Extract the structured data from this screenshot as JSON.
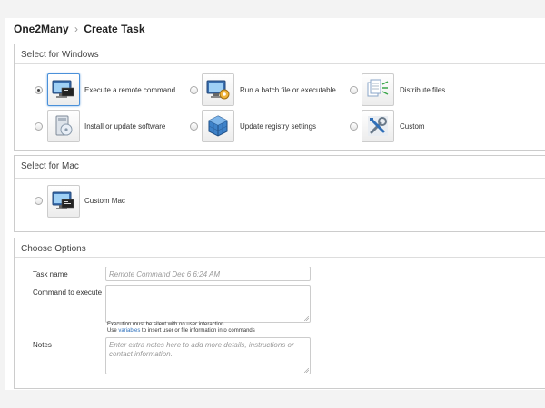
{
  "breadcrumb": {
    "parent": "One2Many",
    "separator": "›",
    "current": "Create Task"
  },
  "windows": {
    "title": "Select for Windows",
    "options": [
      {
        "label": "Execute a remote command",
        "icon": "monitor-console-icon",
        "selected": true
      },
      {
        "label": "Run a batch file or executable",
        "icon": "monitor-gear-icon",
        "selected": false
      },
      {
        "label": "Distribute files",
        "icon": "distribute-files-icon",
        "selected": false
      },
      {
        "label": "Install or update software",
        "icon": "install-software-icon",
        "selected": false
      },
      {
        "label": "Update registry settings",
        "icon": "registry-cube-icon",
        "selected": false
      },
      {
        "label": "Custom",
        "icon": "tools-icon",
        "selected": false
      }
    ]
  },
  "mac": {
    "title": "Select for Mac",
    "options": [
      {
        "label": "Custom Mac",
        "icon": "monitor-console-icon",
        "selected": false
      }
    ]
  },
  "options": {
    "title": "Choose Options",
    "task_name_label": "Task name",
    "task_name_placeholder": "Remote Command Dec 6 6:24 AM",
    "command_label": "Command to execute",
    "command_value": "",
    "help_line1": "Execution must be silent with no user interaction",
    "help_prefix": "Use ",
    "help_link": "variables",
    "help_suffix": " to insert user or file information into commands",
    "notes_label": "Notes",
    "notes_placeholder": "Enter extra notes here to add more details, instructions or contact information."
  },
  "colors": {
    "accent": "#4a90d9",
    "link": "#2a6ebb",
    "border": "#cccccc",
    "background_strip": "#f3f3f3"
  }
}
